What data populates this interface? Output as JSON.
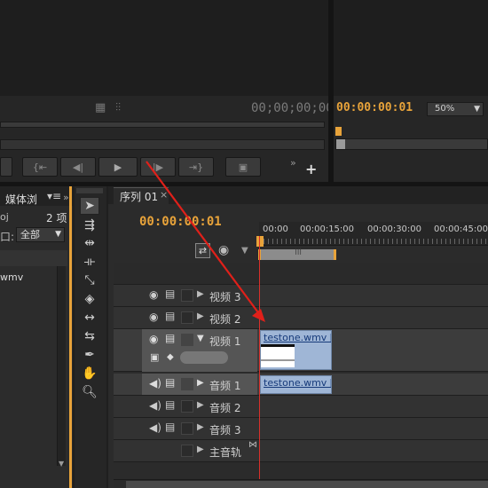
{
  "source_monitor": {
    "timecode": "00;00;00;00",
    "transport_icons": [
      "step-back-icon",
      "rewind-icon",
      "play-icon",
      "step-forward-icon",
      "go-to-out-icon",
      "export-frame-icon",
      "more-icon",
      "add-icon"
    ]
  },
  "program_monitor": {
    "timecode": "00:00:00:01",
    "zoom": "50%"
  },
  "project_panel": {
    "tab_label": "媒体浏",
    "item_name_partial": "oj",
    "item_count": "2 项",
    "filter_label": "口:",
    "filter_value": "全部",
    "list_item": "wmv"
  },
  "timeline": {
    "tab_label": "序列 01",
    "timecode": "00:00:00:01",
    "ruler_labels": [
      "00:00",
      "00:00:15:00",
      "00:00:30:00",
      "00:00:45:00"
    ],
    "tracks": [
      {
        "name": "视频 3",
        "type": "video"
      },
      {
        "name": "视频 2",
        "type": "video"
      },
      {
        "name": "视频 1",
        "type": "video",
        "expanded": true
      },
      {
        "name": "音频 1",
        "type": "audio"
      },
      {
        "name": "音频 2",
        "type": "audio"
      },
      {
        "name": "音频 3",
        "type": "audio"
      },
      {
        "name": "主音轨",
        "type": "master"
      }
    ],
    "video_clip_label": "testone.wmv [视",
    "audio_clip_label": "testone.wmv [音"
  },
  "colors": {
    "accent_timecode": "#e8a33a",
    "playhead": "#d8302a",
    "clip": "#9fb6d6",
    "annotation_arrow": "#e0201a"
  }
}
